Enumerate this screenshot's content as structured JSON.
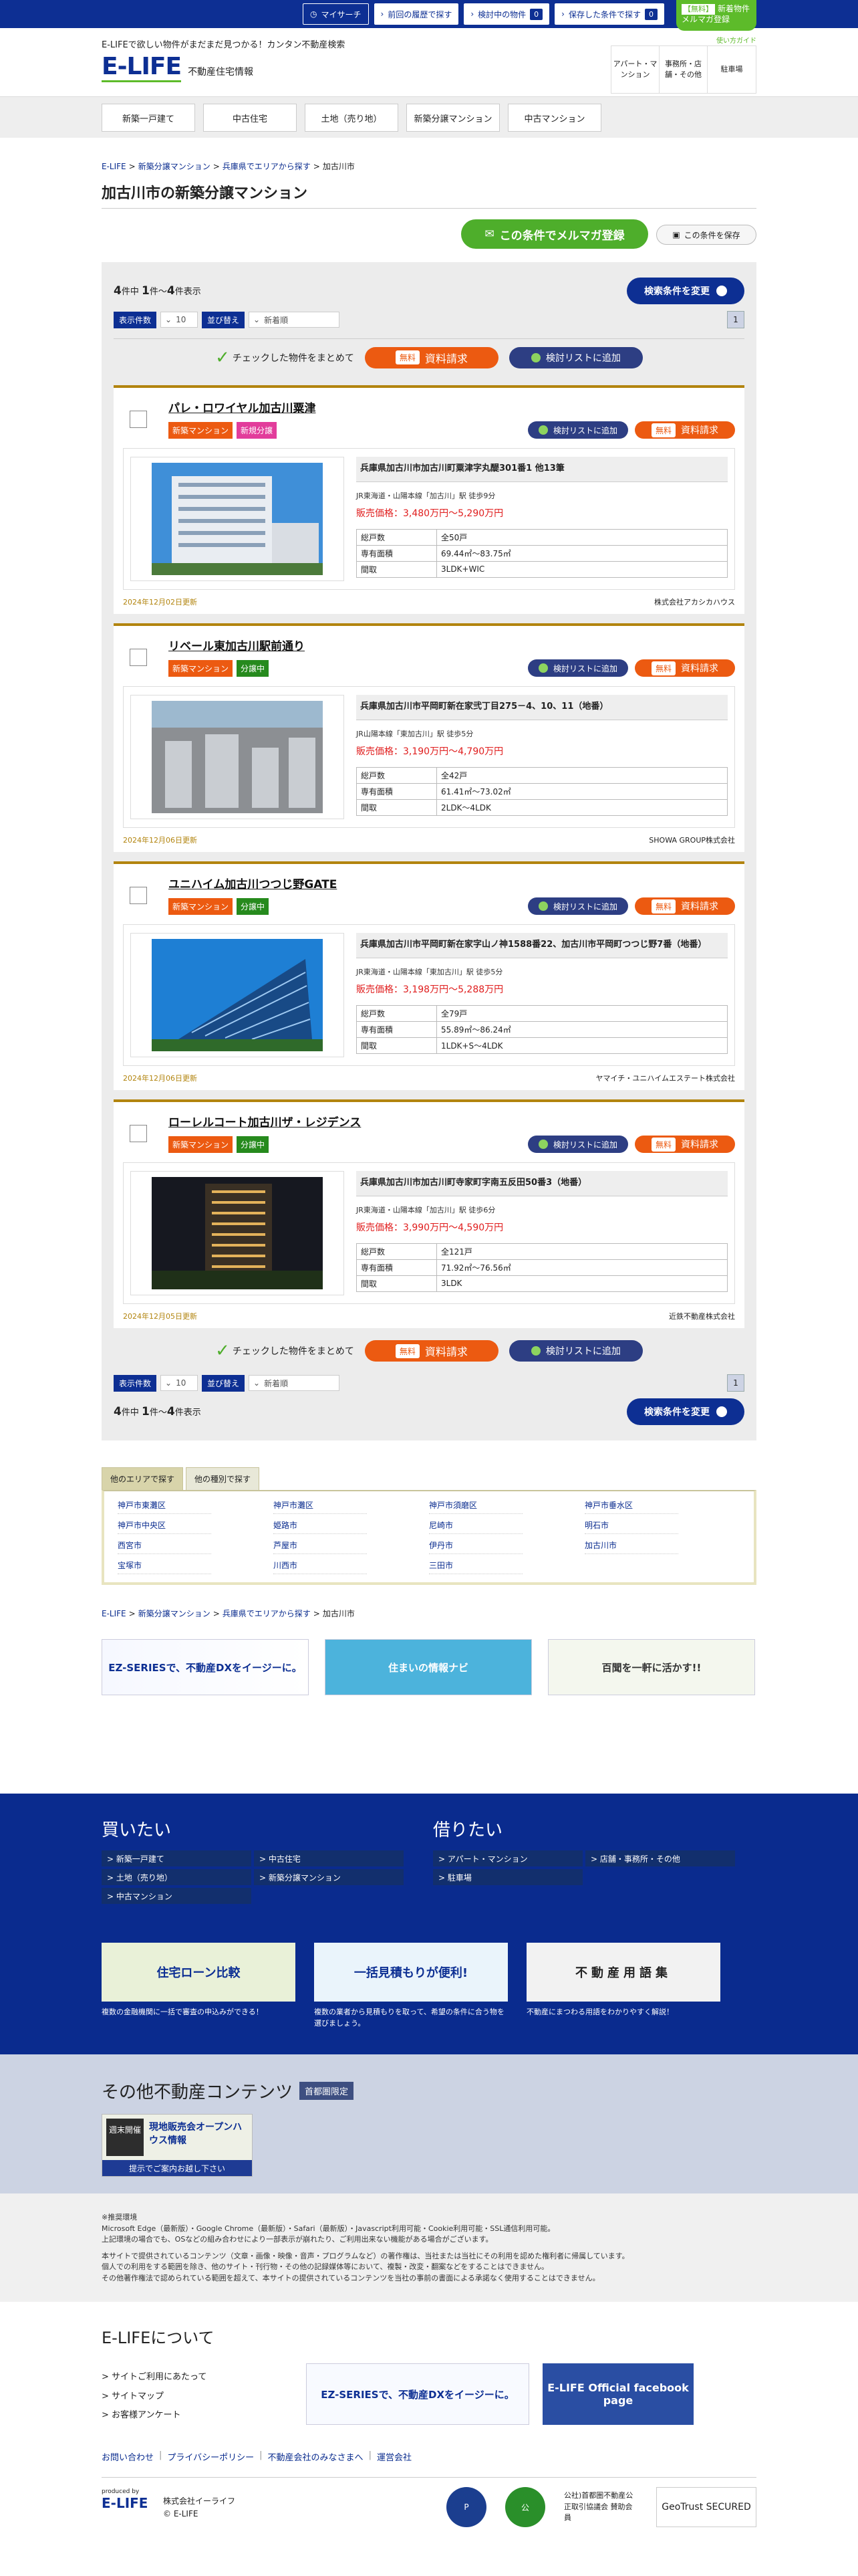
{
  "topbar": {
    "mysearch": "マイサーチ",
    "history": "前回の履歴で探す",
    "kentou": "検討中の物件",
    "kentou_count": "0",
    "saved": "保存した条件で探す",
    "saved_count": "0",
    "magazine_tag": "【無料】",
    "magazine_line1": "新着物件",
    "magazine_line2": "メルマガ登録"
  },
  "header": {
    "tagline": "E-LIFEで欲しい物件がまだまだ見つかる！カンタン不動産検索",
    "logo": "E-LIFE",
    "logo_sub": "不動産住宅情報",
    "help": "使い方ガイド",
    "nav": [
      "アパート・マンション",
      "事務所・店舗・その他",
      "駐車場"
    ]
  },
  "gnav": [
    "新築一戸建て",
    "中古住宅",
    "土地（売り地）",
    "新築分譲マンション",
    "中古マンション"
  ],
  "breadcrumb": [
    "E-LIFE",
    "新築分譲マンション",
    "兵庫県でエリアから探す",
    "加古川市"
  ],
  "page_title": "加古川市の新築分譲マンション",
  "mail_btn": "この条件でメルマガ登録",
  "save_btn": "この条件を保存",
  "counts": {
    "total": "4",
    "total_suffix": "件中",
    "from": "1",
    "sep": "件～",
    "to": "4",
    "to_suffix": "件表示"
  },
  "change_btn": "検索条件を変更",
  "sort": {
    "count_label": "表示件数",
    "count_value": "10",
    "order_label": "並び替え",
    "order_value": "新着順",
    "page": "1"
  },
  "bulk": {
    "check": "チェックした物件をまとめて",
    "free": "無料",
    "request": "資料請求",
    "kentou": "検討リストに追加"
  },
  "properties": [
    {
      "title": "パレ・ロワイヤル加古川粟津",
      "tag1": "新築マンション",
      "tag2": "新規分譲",
      "addr": "兵庫県加古川市加古川町粟津字丸醍301番1 他13筆",
      "access": "JR東海道・山陽本線「加古川」駅 徒歩9分",
      "price": "販売価格：3,480万円～5,290万円",
      "rows": [
        [
          "総戸数",
          "全50戸"
        ],
        [
          "専有面積",
          "69.44㎡～83.75㎡"
        ],
        [
          "間取",
          "3LDK+WIC"
        ]
      ],
      "date": "2024年12月02日更新",
      "company": "株式会社アカシカハウス"
    },
    {
      "title": "リベール東加古川駅前通り",
      "tag1": "新築マンション",
      "tag2": "分譲中",
      "addr": "兵庫県加古川市平岡町新在家弐丁目275－4、10、11（地番）",
      "access": "JR山陽本線「東加古川」駅 徒歩5分",
      "price": "販売価格：3,190万円～4,790万円",
      "rows": [
        [
          "総戸数",
          "全42戸"
        ],
        [
          "専有面積",
          "61.41㎡～73.02㎡"
        ],
        [
          "間取",
          "2LDK～4LDK"
        ]
      ],
      "date": "2024年12月06日更新",
      "company": "SHOWA GROUP株式会社"
    },
    {
      "title": "ユニハイム加古川つつじ野GATE",
      "tag1": "新築マンション",
      "tag2": "分譲中",
      "addr": "兵庫県加古川市平岡町新在家字山ノ神1588番22、加古川市平岡町つつじ野7番（地番）",
      "access": "JR東海道・山陽本線「東加古川」駅 徒歩5分",
      "price": "販売価格：3,198万円～5,288万円",
      "rows": [
        [
          "総戸数",
          "全79戸"
        ],
        [
          "専有面積",
          "55.89㎡～86.24㎡"
        ],
        [
          "間取",
          "1LDK+S～4LDK"
        ]
      ],
      "date": "2024年12月06日更新",
      "company": "ヤマイチ・ユニハイムエステート株式会社"
    },
    {
      "title": "ローレルコート加古川ザ・レジデンス",
      "tag1": "新築マンション",
      "tag2": "分譲中",
      "addr": "兵庫県加古川市加古川町寺家町字南五反田50番3（地番）",
      "access": "JR東海道・山陽本線「加古川」駅 徒歩6分",
      "price": "販売価格：3,990万円～4,590万円",
      "rows": [
        [
          "総戸数",
          "全121戸"
        ],
        [
          "専有面積",
          "71.92㎡～76.56㎡"
        ],
        [
          "間取",
          "3LDK"
        ]
      ],
      "date": "2024年12月05日更新",
      "company": "近鉄不動産株式会社"
    }
  ],
  "prop_buttons": {
    "kentou": "検討リストに追加",
    "free": "無料",
    "request": "資料請求"
  },
  "area": {
    "tab1": "他のエリアで探す",
    "tab2": "他の種別で探す",
    "items": [
      "神戸市東灘区",
      "神戸市灘区",
      "神戸市須磨区",
      "神戸市垂水区",
      "神戸市中央区",
      "姫路市",
      "尼崎市",
      "明石市",
      "西宮市",
      "芦屋市",
      "伊丹市",
      "加古川市",
      "宝塚市",
      "川西市",
      "三田市"
    ]
  },
  "banners": [
    "EZ-SERIESで、不動産DXをイージーに。",
    "住まいの情報ナビ",
    "百聞を一軒に活かす!!"
  ],
  "footer": {
    "buy_title": "買いたい",
    "buy": [
      "新築一戸建て",
      "中古住宅",
      "土地（売り地）",
      "新築分譲マンション",
      "中古マンション"
    ],
    "rent_title": "借りたい",
    "rent": [
      "アパート・マンション",
      "店舗・事務所・その他",
      "駐車場"
    ],
    "fb": [
      {
        "img": "住宅ローン比較",
        "cap": "複数の金融機関に一括で審査の申込みができる！"
      },
      {
        "img": "一括見積もりが便利!",
        "cap": "複数の業者から見積もりを取って、希望の条件に合う物を選びましょう。"
      },
      {
        "img": "不動産用語集",
        "cap": "不動産にまつわる用語をわかりやすく解説！"
      }
    ]
  },
  "other": {
    "title": "その他不動産コンテンツ",
    "badge": "首都圏限定",
    "oh_pin": "週末開催",
    "oh_title": "現地販売会オープンハウス情報",
    "oh_cta": "提示でご案内お越し下さい"
  },
  "notes": [
    "※推奨環境",
    "Microsoft Edge（最新版）・Google Chrome（最新版）・Safari（最新版）・Javascript利用可能・Cookie利用可能・SSL通信利用可能。",
    "上記環境の場合でも、OSなどの組み合わせにより一部表示が崩れたり、ご利用出来ない機能がある場合がございます。",
    "本サイトで提供されているコンテンツ（文章・画像・映像・音声・プログラムなど）の著作権は、当社または当社にその利用を認めた権利者に帰属しています。",
    "個人での利用をする範囲を除き、他のサイト・刊行物・その他の記録媒体等において、複製・改変・翻案などをすることはできません。",
    "その他著作権法で認められている範囲を超えて、本サイトの提供されているコンテンツを当社の事前の書面による承諾なく使用することはできません。"
  ],
  "about": {
    "title": "E-LIFEについて",
    "links": [
      "サイトご利用にあたって",
      "サイトマップ",
      "お客様アンケート"
    ],
    "ez": "EZ-SERIESで、不動産DXをイージーに。",
    "fb": "E-LIFE Official facebook page",
    "flinks": [
      "お問い合わせ",
      "プライバシーポリシー",
      "不動産会社のみなさまへ",
      "運営会社"
    ],
    "produced": "produced by",
    "plogo": "E-LIFE",
    "company": "株式会社イーライフ",
    "copy": "© E-LIFE",
    "seal_text": "公社)首都圏不動産公正取引協議会 賛助会員",
    "geo": "GeoTrust SECURED"
  }
}
